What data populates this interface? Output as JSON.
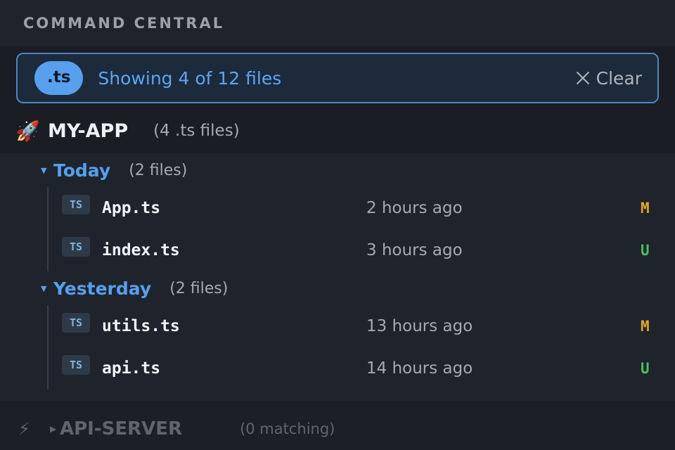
{
  "header": {
    "title": "COMMAND CENTRAL"
  },
  "filter": {
    "chip_label": ".ts",
    "status_text": "Showing 4 of 12 files",
    "clear_label": "Clear"
  },
  "projects": [
    {
      "icon": "rocket-icon",
      "name": "MY-APP",
      "count": "(4 .ts files)",
      "groups": [
        {
          "name": "Today",
          "count": "(2 files)",
          "files": [
            {
              "badge": "TS",
              "name": "App.ts",
              "time": "2 hours ago",
              "status": "M",
              "status_color": "#e3a727"
            },
            {
              "badge": "TS",
              "name": "index.ts",
              "time": "3 hours ago",
              "status": "U",
              "status_color": "#46c15a"
            }
          ]
        },
        {
          "name": "Yesterday",
          "count": "(2 files)",
          "files": [
            {
              "badge": "TS",
              "name": "utils.ts",
              "time": "13 hours ago",
              "status": "M",
              "status_color": "#e3a727"
            },
            {
              "badge": "TS",
              "name": "api.ts",
              "time": "14 hours ago",
              "status": "U",
              "status_color": "#46c15a"
            }
          ]
        }
      ]
    },
    {
      "icon": "lightning-icon",
      "name": "API-SERVER",
      "count": "(0 matching)"
    }
  ]
}
